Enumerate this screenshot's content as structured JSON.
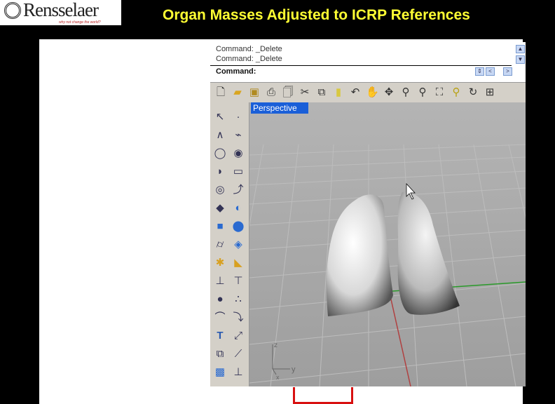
{
  "logo": {
    "name": "Rensselaer",
    "tagline": "why not change the world?"
  },
  "slide_title": "Organ Masses Adjusted to ICRP References",
  "command": {
    "history": [
      "Command: _Delete",
      "Command: _Delete"
    ],
    "prompt": "Command:"
  },
  "toolbar": [
    "new-icon",
    "open-icon",
    "save-icon",
    "print-icon",
    "properties-icon",
    "cut-icon",
    "copy-icon",
    "paste-icon",
    "undo-icon",
    "pan-icon",
    "rotate-icon",
    "zoom-icon",
    "zoom-window-icon",
    "zoom-extents-icon",
    "zoom-selected-icon",
    "rotate-view-icon",
    "four-viewports-icon"
  ],
  "viewport": {
    "tab": "Perspective",
    "axes": {
      "z": "z",
      "y": "y",
      "x": "x"
    }
  },
  "colors": {
    "title": "#ffff33",
    "viewport_tab": "#1a5fd8",
    "bracket": "#d81010"
  }
}
